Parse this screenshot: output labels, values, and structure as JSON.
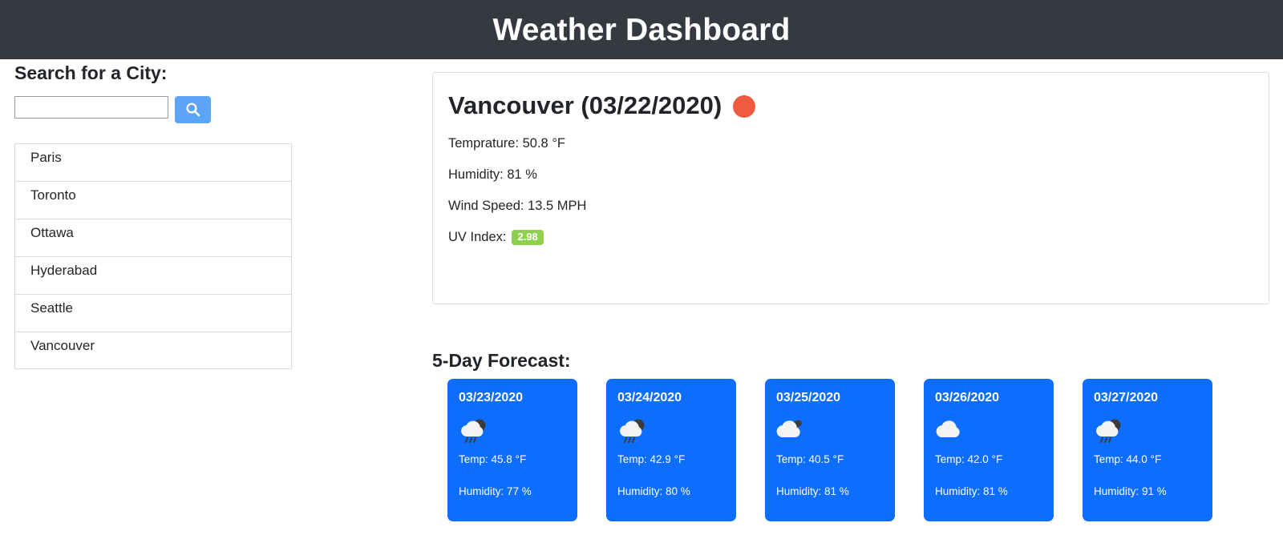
{
  "header": {
    "title": "Weather Dashboard",
    "background": "#343a40"
  },
  "sidebar": {
    "search_label": "Search for a City:",
    "search_input_value": "",
    "search_input_placeholder": "",
    "search_button_icon": "search-icon",
    "cities": [
      {
        "name": "Paris"
      },
      {
        "name": "Toronto"
      },
      {
        "name": "Ottawa"
      },
      {
        "name": "Hyderabad"
      },
      {
        "name": "Seattle"
      },
      {
        "name": "Vancouver"
      }
    ]
  },
  "current": {
    "title": "Vancouver (03/22/2020)",
    "icon": "clear-sun-icon",
    "icon_color": "#ef5b3e",
    "temperature": "Temprature: 50.8 °F",
    "humidity": "Humidity: 81 %",
    "wind_speed": "Wind Speed: 13.5 MPH",
    "uv_label": "UV Index:",
    "uv_value": "2.98",
    "uv_badge_color": "#8fd14f"
  },
  "forecast": {
    "heading": "5-Day Forecast:",
    "card_color": "#0d6efd",
    "days": [
      {
        "date": "03/23/2020",
        "icon": "rain-cloud-icon",
        "temp": "Temp: 45.8 °F",
        "humidity": "Humidity: 77 %"
      },
      {
        "date": "03/24/2020",
        "icon": "rain-cloud-icon",
        "temp": "Temp: 42.9 °F",
        "humidity": "Humidity: 80 %"
      },
      {
        "date": "03/25/2020",
        "icon": "broken-cloud-icon",
        "temp": "Temp: 40.5 °F",
        "humidity": "Humidity: 81 %"
      },
      {
        "date": "03/26/2020",
        "icon": "cloud-icon",
        "temp": "Temp: 42.0 °F",
        "humidity": "Humidity: 81 %"
      },
      {
        "date": "03/27/2020",
        "icon": "rain-cloud-icon",
        "temp": "Temp: 44.0 °F",
        "humidity": "Humidity: 91 %"
      }
    ]
  }
}
